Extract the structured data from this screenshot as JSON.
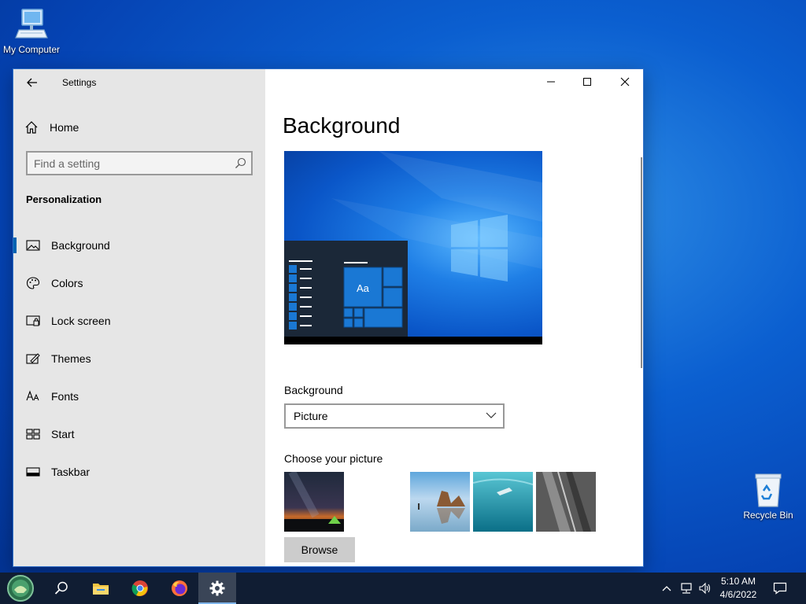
{
  "desktop": {
    "icons": [
      {
        "label": "My Computer"
      },
      {
        "label": "Recycle Bin"
      }
    ]
  },
  "window": {
    "title": "Settings",
    "sidebar": {
      "home_label": "Home",
      "search_placeholder": "Find a setting",
      "section_title": "Personalization",
      "items": [
        {
          "label": "Background",
          "icon": "picture-icon",
          "active": true
        },
        {
          "label": "Colors",
          "icon": "palette-icon"
        },
        {
          "label": "Lock screen",
          "icon": "lock-screen-icon"
        },
        {
          "label": "Themes",
          "icon": "themes-icon"
        },
        {
          "label": "Fonts",
          "icon": "fonts-icon"
        },
        {
          "label": "Start",
          "icon": "start-icon"
        },
        {
          "label": "Taskbar",
          "icon": "taskbar-icon"
        }
      ]
    },
    "content": {
      "page_title": "Background",
      "preview_sample_text": "Aa",
      "background_label": "Background",
      "background_selected": "Picture",
      "choose_label": "Choose your picture",
      "pictures": [
        "night-sky-tent",
        "beach-rocks",
        "underwater-swimmer",
        "rock-cliff"
      ],
      "browse_label": "Browse"
    }
  },
  "taskbar": {
    "apps": [
      "start-icon",
      "search-icon",
      "file-explorer-icon",
      "chrome-icon",
      "firefox-icon",
      "settings-icon"
    ],
    "clock": {
      "time": "5:10 AM",
      "date": "4/6/2022"
    }
  },
  "colors": {
    "accent": "#0063b1",
    "sidebar_bg": "#e6e6e6",
    "taskbar_bg": "#101d33"
  }
}
